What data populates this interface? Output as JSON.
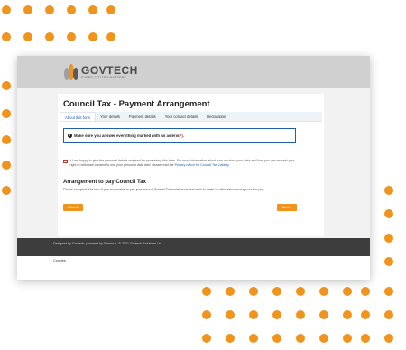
{
  "logo": {
    "name": "GOVTECH",
    "tagline": "EVERY CITIZEN MATTERS",
    "colors": [
      "#f0941e",
      "#a0a0a0",
      "#5a5a5a"
    ]
  },
  "page": {
    "title": "Council Tax - Payment Arrangement",
    "tabs": [
      "About this form",
      "Your details",
      "Payment details",
      "Your contact details",
      "Declaration"
    ],
    "active_tab": "About this form"
  },
  "notice": {
    "text": "Make sure you answer everything marked with an asteris",
    "star": "(*)."
  },
  "consent": {
    "text": "* I am happy to give the personal details required for processing this form. For more information about how we store your data and how you can request your right to withdraw consent to use your personal data later please read the",
    "link": "Privacy notice for Council Tax Liability"
  },
  "section": {
    "title": "Arrangement to pay Council Tax",
    "description": "Please complete this form if you are unable to pay your current Council Tax instalments and wish to make an alternative arrangement to pay."
  },
  "buttons": {
    "cancel": "« Cancel",
    "next": "Next »"
  },
  "footer": {
    "text": "Designed by Govtech, powered by Granicus. © 2021 Govtech Solutions Ltd.",
    "cookies": "Cookies"
  },
  "colors": {
    "accent": "#f0941e",
    "link": "#1f5fa8",
    "header_bg": "#d0d0d0",
    "footer_bg": "#3d3d3d"
  }
}
